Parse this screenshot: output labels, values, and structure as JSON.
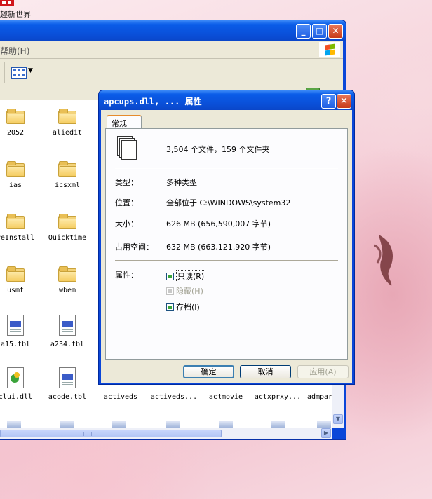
{
  "desktop": {
    "label": "趣新世界"
  },
  "explorer": {
    "menu_help": "帮助(H)",
    "files": [
      {
        "name": "2052",
        "type": "folder"
      },
      {
        "name": "aliedit",
        "type": "folder"
      },
      {
        "name": "ias",
        "type": "folder"
      },
      {
        "name": "icsxml",
        "type": "folder"
      },
      {
        "name": "reInstall",
        "type": "folder"
      },
      {
        "name": "Quicktime",
        "type": "folder"
      },
      {
        "name": "usmt",
        "type": "folder"
      },
      {
        "name": "wbem",
        "type": "folder"
      },
      {
        "name": "a15.tbl",
        "type": "doc"
      },
      {
        "name": "a234.tbl",
        "type": "doc"
      },
      {
        "name": "clui.dll",
        "type": "dll"
      },
      {
        "name": "acode.tbl",
        "type": "doc"
      },
      {
        "name": "activeds",
        "type": "partial"
      },
      {
        "name": "activeds...",
        "type": "partial"
      },
      {
        "name": "actmovie",
        "type": "partial"
      },
      {
        "name": "actxprxy...",
        "type": "partial"
      },
      {
        "name": "admpar",
        "type": "partial"
      }
    ]
  },
  "dialog": {
    "title": "apcups.dll, ... 属性",
    "help_glyph": "?",
    "close_glyph": "✕",
    "tab_general": "常规",
    "summary": "3,504 个文件，159 个文件夹",
    "type_label": "类型：",
    "type_value": "多种类型",
    "location_label": "位置：",
    "location_value": "全部位于 C:\\WINDOWS\\system32",
    "size_label": "大小：",
    "size_value": "626 MB (656,590,007 字节)",
    "disk_label": "占用空间：",
    "disk_value": "632 MB (663,121,920 字节)",
    "attributes_label": "属性：",
    "attr_readonly": "只读(R)",
    "attr_hidden": "隐藏(H)",
    "attr_archive": "存档(I)",
    "ok": "确定",
    "cancel": "取消",
    "apply": "应用(A)"
  }
}
